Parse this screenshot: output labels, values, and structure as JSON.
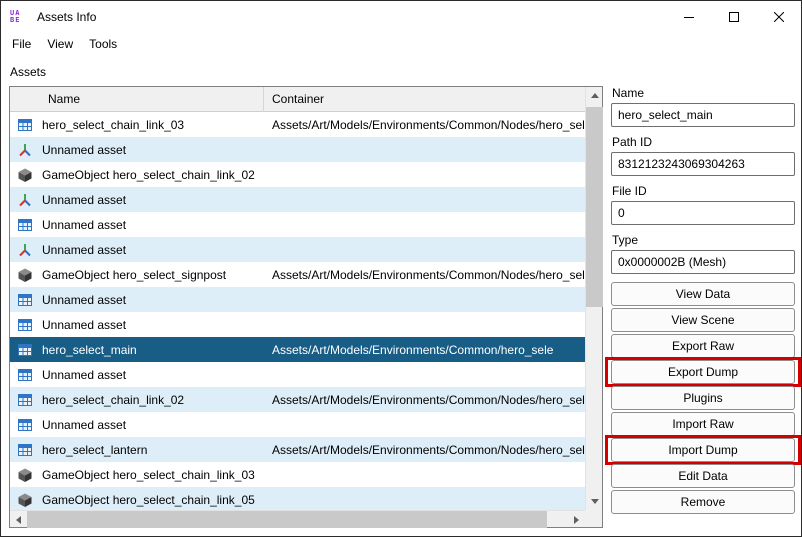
{
  "window": {
    "title": "Assets Info",
    "logo": [
      "UA",
      "BE"
    ]
  },
  "menu": {
    "items": [
      "File",
      "View",
      "Tools"
    ]
  },
  "assets_label": "Assets",
  "table": {
    "columns": [
      "Name",
      "Container"
    ],
    "rows": [
      {
        "icon": "mesh",
        "name": "hero_select_chain_link_03",
        "container": "Assets/Art/Models/Environments/Common/Nodes/hero_sele",
        "selected": false
      },
      {
        "icon": "axes",
        "name": "Unnamed asset",
        "container": "",
        "selected": false
      },
      {
        "icon": "gameobject",
        "name": "GameObject hero_select_chain_link_02",
        "container": "",
        "selected": false
      },
      {
        "icon": "axes",
        "name": "Unnamed asset",
        "container": "",
        "selected": false
      },
      {
        "icon": "mesh",
        "name": "Unnamed asset",
        "container": "",
        "selected": false
      },
      {
        "icon": "axes",
        "name": "Unnamed asset",
        "container": "",
        "selected": false
      },
      {
        "icon": "gameobject",
        "name": "GameObject hero_select_signpost",
        "container": "Assets/Art/Models/Environments/Common/Nodes/hero_sele",
        "selected": false
      },
      {
        "icon": "mesh",
        "name": "Unnamed asset",
        "container": "",
        "selected": false
      },
      {
        "icon": "mesh",
        "name": "Unnamed asset",
        "container": "",
        "selected": false
      },
      {
        "icon": "mesh",
        "name": "hero_select_main",
        "container": "Assets/Art/Models/Environments/Common/hero_sele",
        "selected": true
      },
      {
        "icon": "mesh",
        "name": "Unnamed asset",
        "container": "",
        "selected": false
      },
      {
        "icon": "mesh",
        "name": "hero_select_chain_link_02",
        "container": "Assets/Art/Models/Environments/Common/Nodes/hero_sele",
        "selected": false
      },
      {
        "icon": "mesh",
        "name": "Unnamed asset",
        "container": "",
        "selected": false
      },
      {
        "icon": "mesh",
        "name": "hero_select_lantern",
        "container": "Assets/Art/Models/Environments/Common/Nodes/hero_sele",
        "selected": false
      },
      {
        "icon": "gameobject",
        "name": "GameObject hero_select_chain_link_03",
        "container": "",
        "selected": false
      },
      {
        "icon": "gameobject",
        "name": "GameObject hero_select_chain_link_05",
        "container": "",
        "selected": false
      }
    ]
  },
  "details": {
    "fields": [
      {
        "label": "Name",
        "value": "hero_select_main"
      },
      {
        "label": "Path ID",
        "value": "8312123243069304263"
      },
      {
        "label": "File ID",
        "value": "0"
      },
      {
        "label": "Type",
        "value": "0x0000002B (Mesh)"
      }
    ],
    "buttons": [
      {
        "label": "View Data",
        "highlighted": false
      },
      {
        "label": "View Scene",
        "highlighted": false
      },
      {
        "label": "Export Raw",
        "highlighted": false
      },
      {
        "label": "Export Dump",
        "highlighted": true
      },
      {
        "label": "Plugins",
        "highlighted": false
      },
      {
        "label": "Import Raw",
        "highlighted": false
      },
      {
        "label": "Import Dump",
        "highlighted": true
      },
      {
        "label": "Edit Data",
        "highlighted": false
      },
      {
        "label": "Remove",
        "highlighted": false
      }
    ]
  },
  "colors": {
    "selection": "#175d85",
    "alt-row": "#ddeef8",
    "annotation": "#d40000",
    "mesh-icon-blue": "#2e75c8"
  }
}
